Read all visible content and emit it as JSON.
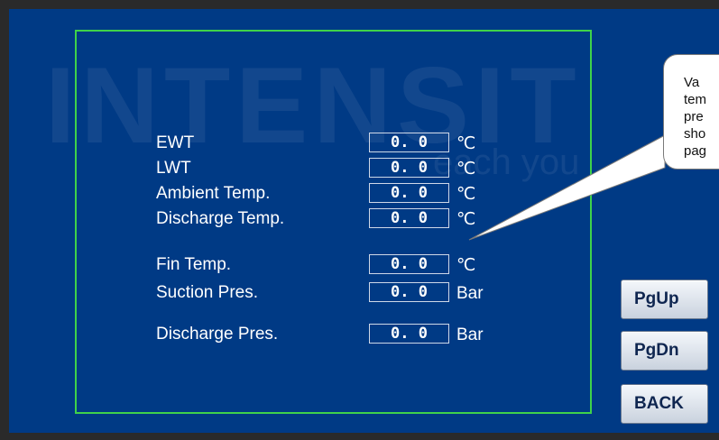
{
  "colors": {
    "screen_bg": "#003a85",
    "panel_border": "#3fd24a",
    "text": "#ffffff",
    "button_text": "#0f2650"
  },
  "watermark": {
    "text": "INTENSIT",
    "sub": "each you"
  },
  "parameters": [
    {
      "label": "EWT",
      "value": "0. 0",
      "unit": "℃"
    },
    {
      "label": "LWT",
      "value": "0. 0",
      "unit": "℃"
    },
    {
      "label": "Ambient Temp.",
      "value": "0. 0",
      "unit": "℃"
    },
    {
      "label": "Discharge Temp.",
      "value": "0. 0",
      "unit": "℃"
    },
    {
      "label": "Fin Temp.",
      "value": "0. 0",
      "unit": "℃"
    },
    {
      "label": "Suction Pres.",
      "value": "0. 0",
      "unit": "Bar"
    },
    {
      "label": "Discharge Pres.",
      "value": "0. 0",
      "unit": "Bar"
    }
  ],
  "buttons": {
    "pgup": "PgUp",
    "pgdn": "PgDn",
    "back": "BACK"
  },
  "callout": {
    "lines": [
      "Va",
      "tem",
      "pre",
      "sho",
      "pag"
    ]
  }
}
